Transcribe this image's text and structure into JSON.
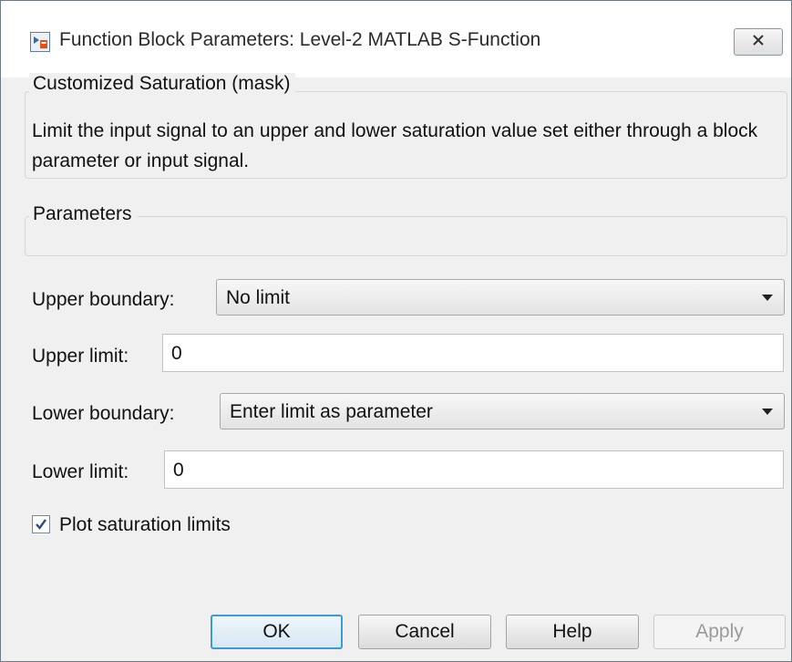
{
  "window": {
    "title": "Function Block Parameters: Level-2 MATLAB S-Function",
    "icon": "simulink-block-icon",
    "close_icon": "close-icon"
  },
  "mask": {
    "legend": "Customized Saturation (mask)",
    "description": "Limit the input signal to an upper and lower saturation value set either through a block parameter or input signal."
  },
  "parameters": {
    "legend": "Parameters",
    "upper_boundary": {
      "label": "Upper boundary:",
      "value": "No limit"
    },
    "upper_limit": {
      "label": "Upper limit:",
      "value": "0"
    },
    "lower_boundary": {
      "label": "Lower boundary:",
      "value": "Enter limit as parameter"
    },
    "lower_limit": {
      "label": "Lower limit:",
      "value": "0"
    },
    "plot_limits": {
      "label": "Plot saturation limits",
      "checked": true
    }
  },
  "buttons": {
    "ok": "OK",
    "cancel": "Cancel",
    "help": "Help",
    "apply": "Apply"
  },
  "colors": {
    "accent": "#3c9ad8",
    "window_bg": "#f0f0f0"
  }
}
